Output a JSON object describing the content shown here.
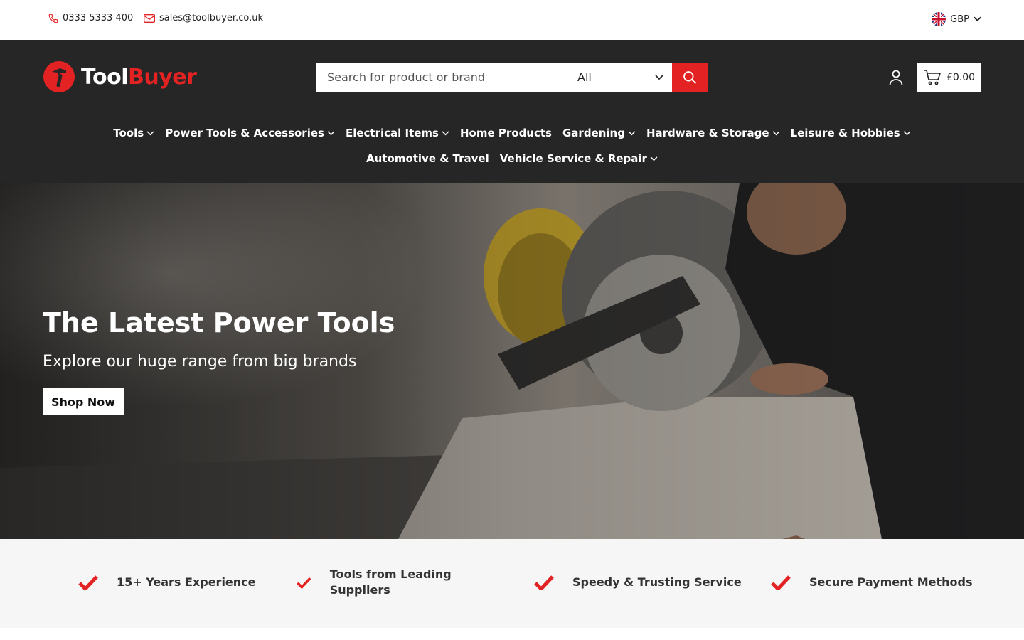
{
  "topbar": {
    "phone": "0333 5333 400",
    "email": "sales@toolbuyer.co.uk",
    "currency": "GBP"
  },
  "brand": {
    "logo_part1": "Tool",
    "logo_part2": "Buyer",
    "accent_color": "#e32323",
    "header_bg": "#262626"
  },
  "search": {
    "placeholder": "Search for product or brand",
    "category": "All"
  },
  "cart": {
    "total": "£0.00"
  },
  "nav": {
    "items": [
      {
        "label": "Tools",
        "has_dropdown": true
      },
      {
        "label": "Power Tools & Accessories",
        "has_dropdown": true
      },
      {
        "label": "Electrical Items",
        "has_dropdown": true
      },
      {
        "label": "Home Products",
        "has_dropdown": false
      },
      {
        "label": "Gardening",
        "has_dropdown": true
      },
      {
        "label": "Hardware & Storage",
        "has_dropdown": true
      },
      {
        "label": "Leisure & Hobbies",
        "has_dropdown": true
      },
      {
        "label": "Automotive & Travel",
        "has_dropdown": false
      },
      {
        "label": "Vehicle Service & Repair",
        "has_dropdown": true
      }
    ]
  },
  "hero": {
    "title": "The Latest Power Tools",
    "subtitle": "Explore our huge range from big brands",
    "cta": "Shop Now"
  },
  "features": [
    {
      "label": "15+ Years Experience"
    },
    {
      "label": "Tools from Leading Suppliers"
    },
    {
      "label": "Speedy & Trusting Service"
    },
    {
      "label": "Secure Payment Methods"
    }
  ]
}
